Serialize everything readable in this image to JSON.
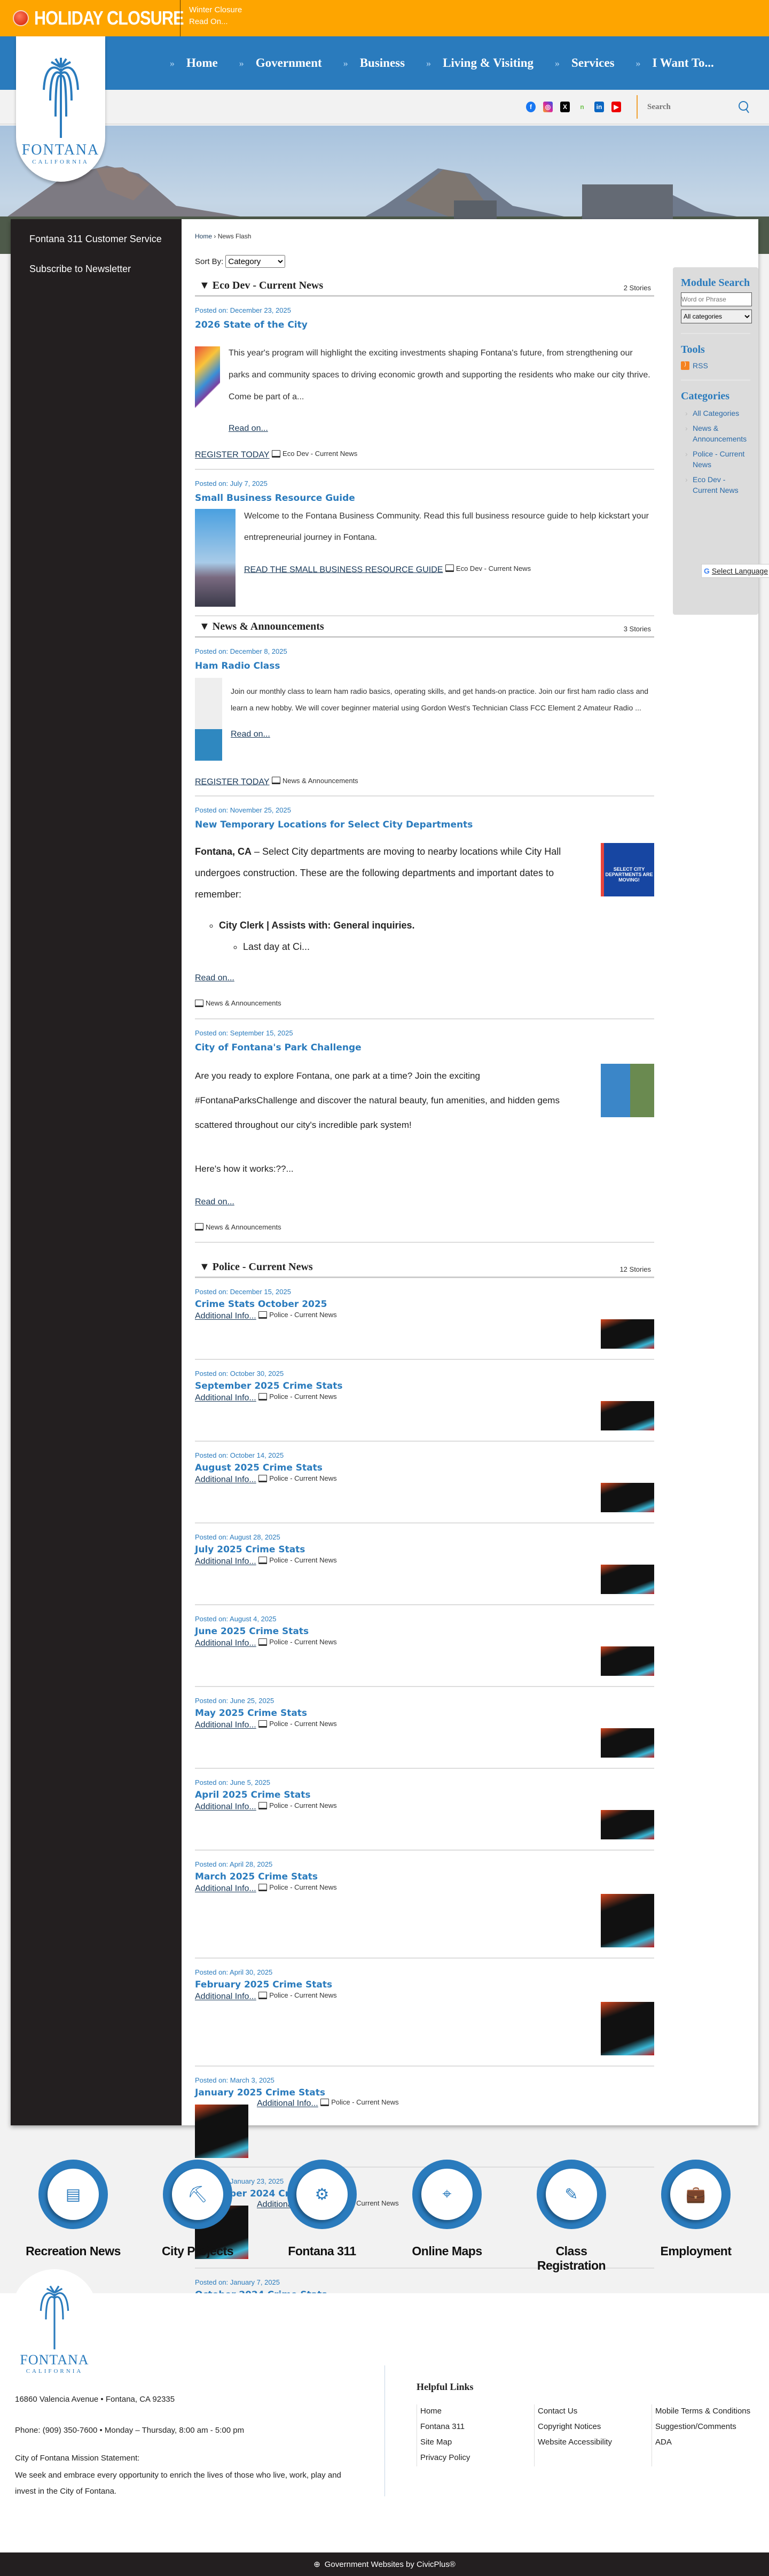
{
  "alert": {
    "title": "HOLIDAY CLOSURE",
    "line1": "Winter Closure",
    "line2": "Read On..."
  },
  "logo": {
    "name": "FONTANA",
    "sub": "CALIFORNIA"
  },
  "nav": [
    "Home",
    "Government",
    "Business",
    "Living & Visiting",
    "Services",
    "I Want To..."
  ],
  "search": {
    "placeholder": "Search"
  },
  "sidebar": [
    "Fontana 311 Customer Service",
    "Subscribe to Newsletter"
  ],
  "breadcrumb": {
    "home": "Home",
    "sep": "›",
    "current": "News Flash"
  },
  "sort": {
    "label": "Sort By:",
    "value": "Category"
  },
  "module": {
    "search_title": "Module Search",
    "search_placeholder": "Word or Phrase",
    "category_value": "All categories",
    "tools_title": "Tools",
    "rss": "RSS",
    "categories_title": "Categories",
    "categories": [
      "All Categories",
      "News & Announcements",
      "Police - Current News",
      "Eco Dev - Current News"
    ]
  },
  "translate": "Select Language",
  "eco": {
    "title": "Eco Dev - Current News",
    "count": "2 Stories",
    "items": [
      {
        "date": "Posted on: December 23, 2025",
        "title": "2026 State of the City",
        "body": "This year's program will highlight the exciting investments shaping Fontana's future, from strengthening our parks and community spaces to driving economic growth and supporting the residents who make our city thrive. Come be part of a...",
        "read": "Read on...",
        "link": "REGISTER TODAY",
        "cat": "Eco Dev - Current News"
      },
      {
        "date": "Posted on: July 7, 2025",
        "title": "Small Business Resource Guide",
        "body": "Welcome to the Fontana Business Community. Read this full business resource guide to help kickstart your entrepreneurial journey in Fontana.",
        "link": "READ THE SMALL BUSINESS RESOURCE GUIDE",
        "cat": "Eco Dev - Current News"
      }
    ]
  },
  "news": {
    "title": "News & Announcements",
    "count": "3 Stories",
    "items": [
      {
        "date": "Posted on: December 8, 2025",
        "title": "Ham Radio Class",
        "body": "Join our monthly class to learn ham radio basics, operating skills, and get hands-on practice. Join our first ham radio class and learn a new hobby. We will cover beginner material using Gordon West's Technician Class FCC Element 2 Amateur Radio ...",
        "read": "Read on...",
        "link": "REGISTER TODAY",
        "cat": "News & Announcements"
      },
      {
        "date": "Posted on: November 25, 2025",
        "title": "New Temporary Locations for Select City Departments",
        "lead": "Fontana, CA",
        "body": " – Select City departments are moving to nearby locations while City Hall undergoes construction. These are the following departments and important dates to remember:",
        "bullet": "City Clerk | Assists with: General inquiries.",
        "subbullet": "Last day at Ci...",
        "read": "Read on...",
        "cat": "News & Announcements",
        "img_text": "SELECT CITY DEPARTMENTS ARE MOVING!"
      },
      {
        "date": "Posted on: September 15, 2025",
        "title": "City of Fontana's Park Challenge",
        "body": "Are you ready to explore Fontana, one park at a time? Join the exciting #FontanaParksChallenge and discover the natural beauty, fun amenities, and hidden gems scattered throughout our city's incredible park system!",
        "body2": "Here's how it works:??...",
        "read": "Read on...",
        "cat": "News & Announcements"
      }
    ]
  },
  "police": {
    "title": "Police - Current News",
    "count": "12 Stories",
    "more": "Additional Info...",
    "cat": "Police - Current News",
    "items": [
      {
        "date": "Posted on: December 15, 2025",
        "title": "Crime Stats October 2025"
      },
      {
        "date": "Posted on: October 30, 2025",
        "title": "September 2025 Crime Stats"
      },
      {
        "date": "Posted on: October 14, 2025",
        "title": "August 2025 Crime Stats"
      },
      {
        "date": "Posted on: August 28, 2025",
        "title": "July 2025 Crime Stats"
      },
      {
        "date": "Posted on: August 4, 2025",
        "title": "June 2025 Crime Stats"
      },
      {
        "date": "Posted on: June 25, 2025",
        "title": "May 2025 Crime Stats"
      },
      {
        "date": "Posted on: June 5, 2025",
        "title": "April 2025 Crime Stats"
      },
      {
        "date": "Posted on: April 28, 2025",
        "title": "March 2025 Crime Stats"
      },
      {
        "date": "Posted on: April 30, 2025",
        "title": "February 2025 Crime Stats"
      },
      {
        "date": "Posted on: March 3, 2025",
        "title": "January 2025 Crime Stats"
      },
      {
        "date": "Posted on: January 23, 2025",
        "title": "December 2024 Crime Stats"
      },
      {
        "date": "Posted on: January 7, 2025",
        "title": "October 2024 Crime Stats"
      }
    ]
  },
  "quicklinks": [
    "Recreation News",
    "City Projects",
    "Fontana 311",
    "Online Maps",
    "Class Registration",
    "Employment"
  ],
  "footer": {
    "title": "Fontana City Hall",
    "address": "16860 Valencia Avenue • Fontana, CA 92335",
    "phone": "Phone: (909) 350-7600 • Monday – Thursday, 8:00 am - 5:00 pm",
    "mission_label": "City of Fontana Mission Statement:",
    "mission": "We seek and embrace every opportunity to enrich the lives of those who live, work, play and invest in the City of Fontana.",
    "links_title": "Helpful Links",
    "links": [
      [
        "Home",
        "Fontana 311",
        "Site Map",
        "Privacy Policy"
      ],
      [
        "Contact Us",
        "Copyright Notices",
        "Website Accessibility"
      ],
      [
        "Mobile Terms & Conditions",
        "Suggestion/Comments",
        "ADA"
      ]
    ],
    "credit": "Government Websites by CivicPlus®"
  },
  "colors": {
    "brand": "#2a7bbd",
    "alert": "#fea500",
    "dark": "#231f20"
  }
}
